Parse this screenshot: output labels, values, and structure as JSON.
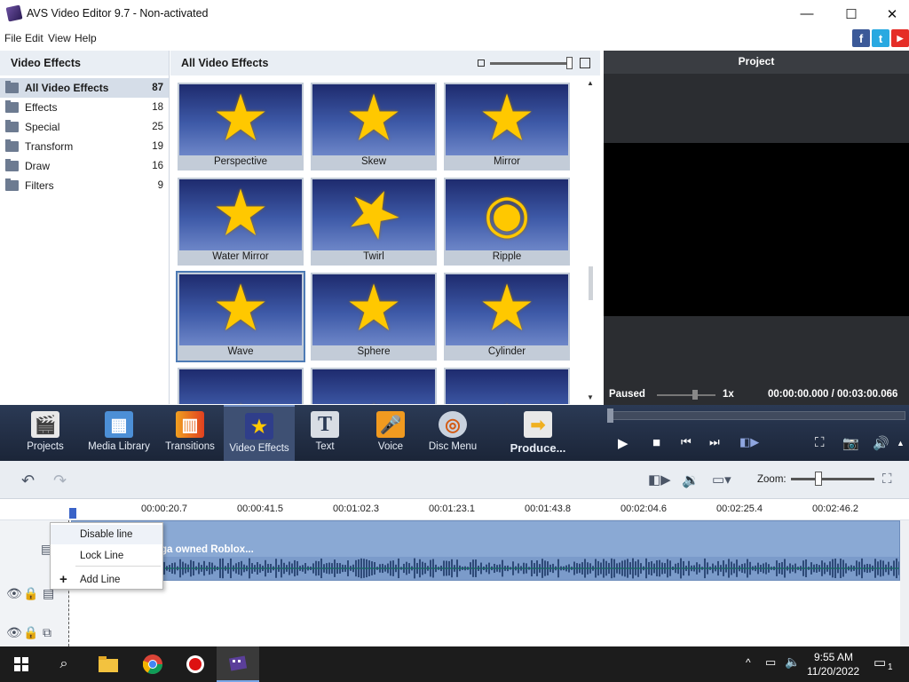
{
  "window": {
    "title": "AVS Video Editor 9.7 - Non-activated",
    "min_symbol": "—",
    "max_symbol": "☐",
    "close_symbol": "✕"
  },
  "menu": {
    "items": [
      "File",
      "Edit",
      "View",
      "Help"
    ]
  },
  "social": {
    "facebook": "f",
    "twitter": "t",
    "youtube": "▶"
  },
  "left_panel": {
    "title": "Video Effects",
    "categories": [
      {
        "label": "All Video Effects",
        "count": "87"
      },
      {
        "label": "Effects",
        "count": "18"
      },
      {
        "label": "Special",
        "count": "25"
      },
      {
        "label": "Transform",
        "count": "19"
      },
      {
        "label": "Draw",
        "count": "16"
      },
      {
        "label": "Filters",
        "count": "9"
      }
    ]
  },
  "gallery": {
    "title": "All Video Effects",
    "tiles": [
      {
        "label": "Perspective"
      },
      {
        "label": "Skew"
      },
      {
        "label": "Mirror"
      },
      {
        "label": "Water Mirror"
      },
      {
        "label": "Twirl"
      },
      {
        "label": "Ripple"
      },
      {
        "label": "Wave"
      },
      {
        "label": "Sphere"
      },
      {
        "label": "Cylinder"
      }
    ]
  },
  "preview": {
    "title": "Project",
    "status": "Paused",
    "speed": "1x",
    "timecode": "00:00:00.000  /  00:03:00.066"
  },
  "toolbar": {
    "items": [
      {
        "label": "Projects",
        "icon": "clapper-icon"
      },
      {
        "label": "Media Library",
        "icon": "film-icon"
      },
      {
        "label": "Transitions",
        "icon": "transitions-icon"
      },
      {
        "label": "Video Effects",
        "icon": "star-icon"
      },
      {
        "label": "Text",
        "icon": "text-icon"
      },
      {
        "label": "Voice",
        "icon": "microphone-icon"
      },
      {
        "label": "Disc Menu",
        "icon": "disc-icon"
      },
      {
        "label": "Produce...",
        "icon": "produce-icon"
      }
    ],
    "active": "Video Effects"
  },
  "timeline": {
    "zoom_label": "Zoom:",
    "ruler_ticks": [
      "00:00:20.7",
      "00:00:41.5",
      "00:01:02.3",
      "00:01:23.1",
      "00:01:43.8",
      "00:02:04.6",
      "00:02:25.4",
      "00:02:46.2"
    ],
    "clip_title": "ga owned Roblox..."
  },
  "context_menu": {
    "items": [
      "Disable line",
      "Lock Line",
      "Add Line"
    ]
  },
  "taskbar": {
    "time": "9:55 AM",
    "date": "11/20/2022",
    "notifications": "1"
  },
  "colors": {
    "accent": "#3e5073",
    "thumb_star": "#ffc800",
    "preview_bg": "#2b2d31"
  }
}
